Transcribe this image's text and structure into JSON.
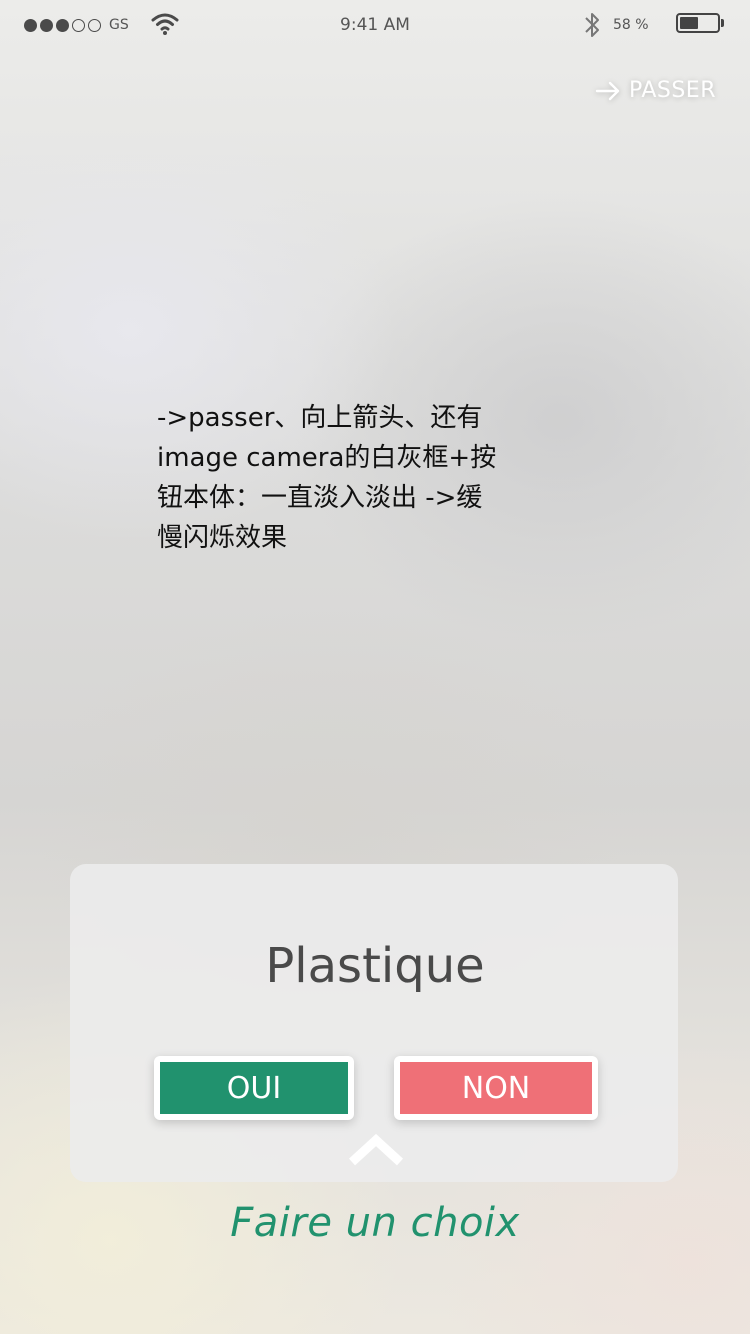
{
  "status_bar": {
    "carrier": "GS",
    "time": "9:41 AM",
    "battery_percent": "58 %",
    "battery_level": 0.5,
    "signal_bars_filled": 3,
    "signal_bars_total": 5
  },
  "skip_button": {
    "label": "PASSER",
    "icon": "arrow-right-icon"
  },
  "note": {
    "line1": "->passer、向上箭头、还有",
    "line2": "image camera的白灰框+按",
    "line3": "钮本体：一直淡入淡出 ->缓",
    "line4": "慢闪烁效果"
  },
  "card": {
    "title": "Plastique",
    "yes_label": "OUI",
    "no_label": "NON",
    "expand_icon": "chevron-up-icon"
  },
  "hint": "Faire un choix",
  "colors": {
    "accent_green": "#21926e",
    "accent_red": "#ef7077"
  }
}
